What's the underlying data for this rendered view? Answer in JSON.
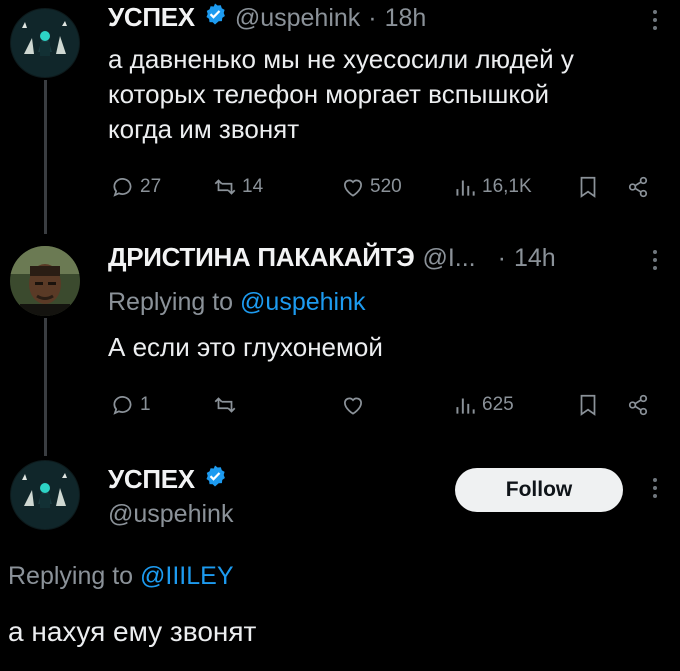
{
  "tweet1": {
    "name": "УСПЕХ",
    "handle": "@uspehink",
    "sep": "·",
    "time": "18h",
    "text_lines": [
      "а давненько мы не хуесосили людей у",
      "которых телефон моргает вспышкой",
      "когда им звонят"
    ],
    "replies": "27",
    "retweets": "14",
    "likes": "520",
    "views": "16,1K"
  },
  "tweet2": {
    "name": "ДРИСТИНА ПАКАКАЙТЭ",
    "handle": "@I...",
    "sep": "·",
    "time": "14h",
    "replying_prefix": "Replying to",
    "replying_handle": "@uspehink",
    "text": "А если это глухонемой",
    "replies": "1",
    "retweets": "",
    "likes": "",
    "views": "625"
  },
  "tweet3": {
    "name": "УСПЕХ",
    "handle": "@uspehink",
    "follow_label": "Follow",
    "replying_prefix": "Replying to",
    "replying_handle": "@IIILEY",
    "text": "а нахуя ему звонят"
  },
  "icons": [
    "verified-icon",
    "reply-icon",
    "retweet-icon",
    "like-icon",
    "views-icon",
    "bookmark-icon",
    "share-icon",
    "more-icon"
  ],
  "colors": {
    "accent": "#1d9bf0",
    "background": "#000000",
    "muted": "#8b9299"
  }
}
